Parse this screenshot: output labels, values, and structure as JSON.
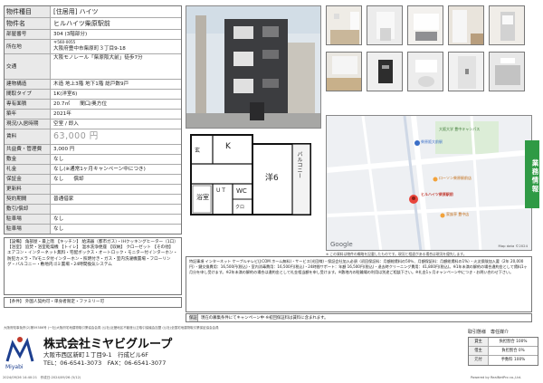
{
  "header": {
    "type_label": "物件種目",
    "type_value": "[住居用] ハイツ"
  },
  "info": {
    "rows": [
      {
        "label": "物件名",
        "value": "ヒルハイツ柴原駅前"
      },
      {
        "label": "部屋番号",
        "value": "304 (3階部分)"
      },
      {
        "label": "所在地",
        "value_small": "〒560-0055",
        "value": "大阪府豊中市柴原町３丁目9-18"
      },
      {
        "label": "交通",
        "value": "大阪モノレール「柴原阪大前」徒歩7分"
      },
      {
        "label": "建物構造",
        "value": "木造 地上3階 地下1階 総戸数9戸"
      },
      {
        "label": "間取タイプ",
        "value": "1K(洋室6)"
      },
      {
        "label": "専有面積",
        "value": "20.7㎡　　間口/奥方位"
      },
      {
        "label": "築年",
        "value": "2021年"
      },
      {
        "label": "現況/入居時期",
        "value": "空室 / 即入"
      },
      {
        "label": "賃料",
        "value": "63,000 円"
      },
      {
        "label": "共益費・管理費",
        "value": "3,000 円"
      },
      {
        "label": "敷金",
        "value": "なし"
      },
      {
        "label": "礼金",
        "value": "なし(※通常1ヶ月キャンペーン中につき)"
      },
      {
        "label": "保証金",
        "value": "なし　　償却"
      },
      {
        "label": "更新料",
        "value": ""
      },
      {
        "label": "契約期間",
        "value": "普通借家"
      },
      {
        "label": "敷引/償却",
        "value": ""
      },
      {
        "label": "駐車場",
        "value": "なし"
      },
      {
        "label": "駐車場",
        "value": "なし"
      }
    ]
  },
  "plan": {
    "rooms": {
      "genkan": "玄",
      "kitchen": "K",
      "ut": "U T",
      "wc": "WC",
      "washroom": "浴室",
      "kuro": "クロ",
      "youshitsu": "洋6",
      "balcony": "バルコニー"
    }
  },
  "map": {
    "labels": {
      "station": "柴原阪大前駅",
      "place1": "大阪大学 豊中キャンパス",
      "place2": "ローソン柴原駅前店",
      "place3": "ヒルハイツ柴原駅前",
      "place4": "家族亭 豊中店",
      "google": "Google",
      "mapdata": "Map data ©2024"
    },
    "note": "※ この資料は物件の概略を記載したものです。現況と相違がある場合は現況を優先します。"
  },
  "side_label": "業務情報",
  "facilities_text": "【設備】 角部屋・最上階 【キッチン】 給湯器（都市ガス）・IHクッキングヒーター（1口）【浴室】 追焚・浴室乾燥機 【トイレ】 温水洗浄便座 【収納】 クローゼット 【その他】 エアコン・インターネット無料・宅配ボックス・オートロック・モニター付インターホン・防犯カメラ・TVモニタ付インターホン・照明付き・ガス・室内洗濯機置場・フローリング・バルコニー・敷地内ゴミ置場・24時間換気システム",
  "conditions_text": "【条件】 外国人契約可・単身者限定・ファミリー可",
  "notes_text": "特記事項 インターネット ケーブルテレビ(J:COM ホーム無料)・サービス(光回線)・保証会社加入必須（初回保証料：月額総賃料の50％、月額保証料：月額総賃料の1%）・火災保険加入要（2年 20,000円）・鍵交換費用：16,500円(税込)・室内消毒費用：16,500円(税込)・24時間サポート：年額 16,500円(税込)・退去時クリーニング費用：41,800円(税込)。※1年未満の解約の場合違約金として賃料1ヶ月分を申し受けます。※2年未満の解約の場合は違約金として礼金相当額を申し受けます。※敷地内の駐輪場の利用は別途ご相談下さい。※礼金1ヶ月キャンペーン中につき・お問い合わせ下さい。",
  "guarantee": {
    "label": "保証",
    "text": "現在の募集条件にてキャンペーン中 ※初回保証料は賃料に含まれます。"
  },
  "footer": {
    "license_line": "大阪府知事免許(2)第59386号 (一社)大阪府宅地建物取引業協会会員 (公社)近畿地区不動産公正取引協議会加盟 (公社)全国宅地建物取引業保証協会会員",
    "company_name": "株式会社ミヤビグループ",
    "address": "大阪市西区新町１丁目9-1　行成ビル6F",
    "tel": "TEL：06-6541-3073　FAX：06-6541-3077",
    "print_date": "2024/09/26 14:40:21　作成日:2024/09/26 (5/12)",
    "powered": "Powered by RealNetPro co.,Ltd."
  },
  "fees": {
    "title": "取引態様　専任媒介",
    "rows": [
      {
        "h": "貸主",
        "c": "負担割合 100%"
      },
      {
        "h": "借主",
        "c": "負担割合 0%"
      },
      {
        "h": "元付",
        "c": "手数料 100%"
      }
    ]
  },
  "photo_note": "外観写真"
}
